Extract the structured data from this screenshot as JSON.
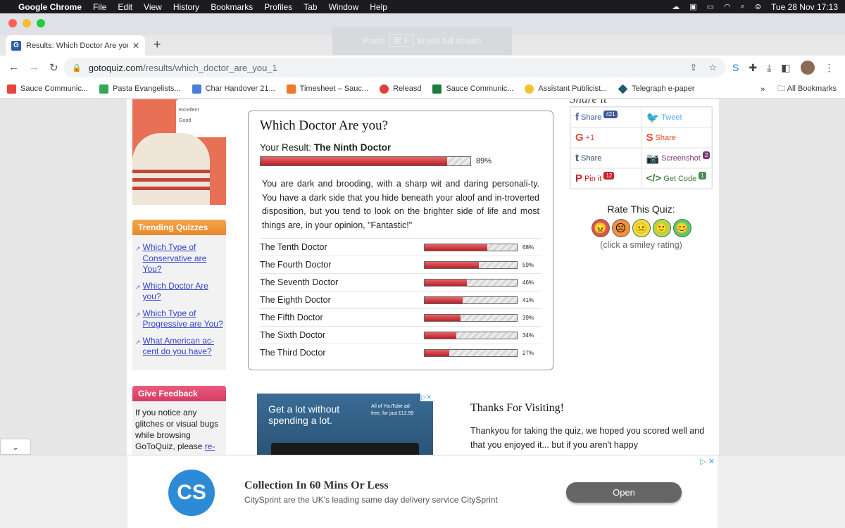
{
  "menubar": {
    "app": "Google Chrome",
    "items": [
      "File",
      "Edit",
      "View",
      "History",
      "Bookmarks",
      "Profiles",
      "Tab",
      "Window",
      "Help"
    ],
    "datetime": "Tue 28 Nov  17:13"
  },
  "tab": {
    "title": "Results: Which Doctor Are you",
    "favicon": "G",
    "close": "✕",
    "new": "+"
  },
  "fullscreen": {
    "press": "Press",
    "key": "⌘ F",
    "suffix": "to exit full screen"
  },
  "address": {
    "host": "gotoquiz.com",
    "path": "/results/which_doctor_are_you_1"
  },
  "bookmarks": {
    "items": [
      {
        "label": "Sauce Communic...",
        "color": "#e8453c"
      },
      {
        "label": "Pasta Evangelists...",
        "color": "#34a853"
      },
      {
        "label": "Char Handover 21...",
        "color": "#4a7fd6"
      },
      {
        "label": "Timesheet – Sauc...",
        "color": "#f07a2a"
      },
      {
        "label": "Releasd",
        "color": "#e0403a"
      },
      {
        "label": "Sauce Communic...",
        "color": "#1e7d3e"
      },
      {
        "label": "Assistant Publicist...",
        "color": "#f2c230"
      },
      {
        "label": "Telegraph e-paper",
        "color": "#1e5c6e"
      }
    ],
    "more": "»",
    "all": "All Bookmarks"
  },
  "sidead": {
    "excellent": "Excellent",
    "good": "Good"
  },
  "trending": {
    "title": "Trending Quizzes",
    "items": [
      "Which Type of Conservative are You?",
      "Which Doctor Are you?",
      "Which Type of Progressive are You?",
      "What American ac-cent do you have?"
    ]
  },
  "feedback": {
    "title": "Give Feedback",
    "text": "If you notice any glitches or visual bugs while browsing GoToQuiz, please ",
    "link": "re-"
  },
  "result": {
    "heading": "Which Doctor Are you?",
    "label": "Your Result:",
    "name": "The Ninth Doctor",
    "percent": 89,
    "percent_text": "89%",
    "description": "You are dark and brooding, with a sharp wit and daring personali-ty. You have a dark side that you hide beneath your aloof and in-troverted disposition, but you tend to look on the brighter side of life and most things are, in your opinion, \"Fantastic!\"",
    "others": [
      {
        "name": "The Tenth Doctor",
        "percent": 68,
        "text": "68%"
      },
      {
        "name": "The Fourth Doctor",
        "percent": 59,
        "text": "59%"
      },
      {
        "name": "The Seventh Doctor",
        "percent": 46,
        "text": "46%"
      },
      {
        "name": "The Eighth Doctor",
        "percent": 41,
        "text": "41%"
      },
      {
        "name": "The Fifth Doctor",
        "percent": 39,
        "text": "39%"
      },
      {
        "name": "The Sixth Doctor",
        "percent": 34,
        "text": "34%"
      },
      {
        "name": "The Third Doctor",
        "percent": 27,
        "text": "27%"
      }
    ]
  },
  "share": {
    "title": "Share it",
    "buttons": [
      {
        "icon": "f",
        "label": "Share",
        "badge": "421",
        "color": "#3b5998",
        "badge_color": "#3b5998"
      },
      {
        "icon": "🐦",
        "label": "Tweet",
        "badge": "",
        "color": "#55acee",
        "badge_color": ""
      },
      {
        "icon": "G",
        "label": "+1",
        "badge": "",
        "color": "#dd4b39",
        "badge_color": ""
      },
      {
        "icon": "S",
        "label": "Share",
        "badge": "",
        "color": "#eb4924",
        "badge_color": ""
      },
      {
        "icon": "t",
        "label": "Share",
        "badge": "",
        "color": "#35465c",
        "badge_color": ""
      },
      {
        "icon": "📷",
        "label": "Screenshot",
        "badge": "2",
        "color": "#7a3b7a",
        "badge_color": "#7a3b7a"
      },
      {
        "icon": "P",
        "label": "Pin it",
        "badge": "12",
        "color": "#cb2027",
        "badge_color": "#cb2027"
      },
      {
        "icon": "</>",
        "label": "Get Code",
        "badge": "1",
        "color": "#3f7a3f",
        "badge_color": "#4a8a4a"
      }
    ]
  },
  "rate": {
    "title": "Rate This Quiz:",
    "smileys": [
      {
        "face": "😠",
        "color": "#e4514a"
      },
      {
        "face": "☹",
        "color": "#f0913e"
      },
      {
        "face": "😐",
        "color": "#e8e040"
      },
      {
        "face": "🙂",
        "color": "#a6e04a"
      },
      {
        "face": "😊",
        "color": "#4ed06a"
      }
    ],
    "hint": "(click a smiley rating)"
  },
  "ytad": {
    "headline": "Get a lot without spending a lot.",
    "offer": "All of YouTube ad-free, for just £12.99"
  },
  "thanks": {
    "title": "Thanks For Visiting!",
    "text": "Thankyou for taking the quiz, we hoped you scored well and that you enjoyed it... but if you aren't happy"
  },
  "bottomad": {
    "logo": "CS",
    "headline": "Collection In 60 Mins Or Less",
    "sub": "CitySprint are the UK's leading same day delivery service CitySprint",
    "button": "Open"
  }
}
